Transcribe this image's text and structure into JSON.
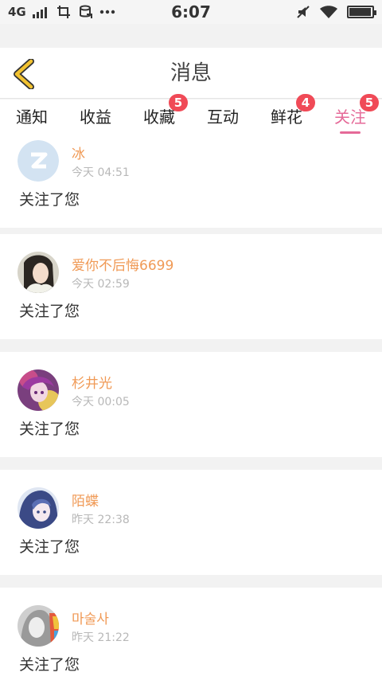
{
  "status_bar": {
    "network": "4G",
    "time": "6:07",
    "battery_level": 0.95
  },
  "header": {
    "title": "消息",
    "back_icon": "chevron-left-icon"
  },
  "colors": {
    "accent": "#e56a98",
    "badge": "#f04a57",
    "name": "#f09a56",
    "back_arrow": "#f2c230"
  },
  "tabs": [
    {
      "label": "通知",
      "badge": "",
      "active": false
    },
    {
      "label": "收益",
      "badge": "",
      "active": false
    },
    {
      "label": "收藏",
      "badge": "5",
      "active": false
    },
    {
      "label": "互动",
      "badge": "",
      "active": false
    },
    {
      "label": "鲜花",
      "badge": "4",
      "active": false
    },
    {
      "label": "关注",
      "badge": "5",
      "active": true
    }
  ],
  "messages": [
    {
      "name": "冰",
      "time": "今天 04:51",
      "text": "关注了您",
      "avatar": "default-avatar-icon"
    },
    {
      "name": "爱你不后悔6699",
      "time": "今天 02:59",
      "text": "关注了您",
      "avatar": "photo-avatar"
    },
    {
      "name": "杉井光",
      "time": "今天 00:05",
      "text": "关注了您",
      "avatar": "anime-avatar"
    },
    {
      "name": "陌蝶",
      "time": "昨天 22:38",
      "text": "关注了您",
      "avatar": "anime-avatar"
    },
    {
      "name": "마술사",
      "time": "昨天 21:22",
      "text": "关注了您",
      "avatar": "sketch-avatar"
    }
  ]
}
